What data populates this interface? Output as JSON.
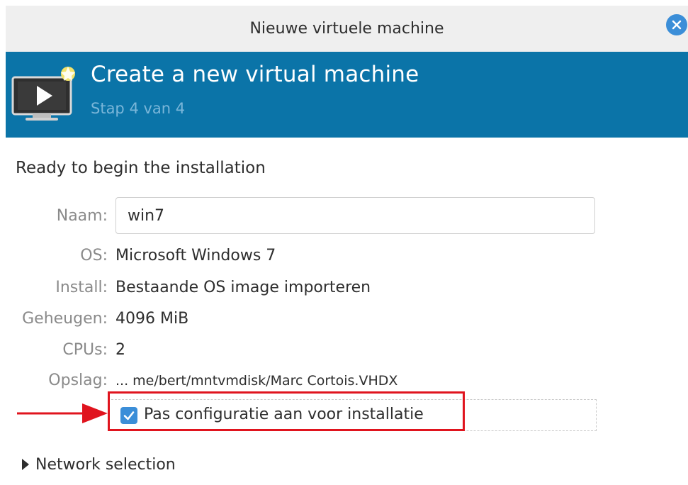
{
  "window": {
    "title": "Nieuwe virtuele machine",
    "close_icon": "close-icon"
  },
  "header": {
    "title": "Create a new virtual machine",
    "subtitle": "Stap 4 van 4",
    "icon": "new-vm-monitor-icon"
  },
  "summary": {
    "heading": "Ready to begin the installation",
    "name": {
      "label": "Naam:",
      "value": "win7"
    },
    "os": {
      "label": "OS:",
      "value": "Microsoft Windows 7"
    },
    "install": {
      "label": "Install:",
      "value": "Bestaande OS image importeren"
    },
    "memory": {
      "label": "Geheugen:",
      "value": "4096 MiB"
    },
    "cpus": {
      "label": "CPUs:",
      "value": "2"
    },
    "storage": {
      "label": "Opslag:",
      "value": "... me/bert/mntvmdisk/Marc Cortois.VHDX"
    }
  },
  "customize": {
    "label": "Pas configuratie aan voor installatie",
    "checked": true
  },
  "network": {
    "label": "Network selection",
    "expanded": false
  },
  "colors": {
    "header_bg": "#0b74a8",
    "accent": "#3b8ed8",
    "annotation_red": "#e0141e"
  }
}
